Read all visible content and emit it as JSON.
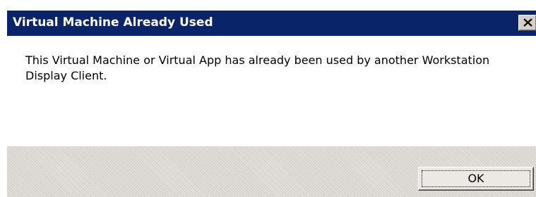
{
  "dialog": {
    "title": "Virtual Machine Already Used",
    "close_icon": "close-x-icon",
    "message": "This Virtual Machine or Virtual App has already been used by another Workstation Display Client.",
    "ok_label": "OK"
  },
  "colors": {
    "titlebar": "#0a246a",
    "title_text": "#ffffff",
    "body": "#ffffff",
    "footer": "#e4e2de",
    "button_face": "#ece9e4"
  }
}
